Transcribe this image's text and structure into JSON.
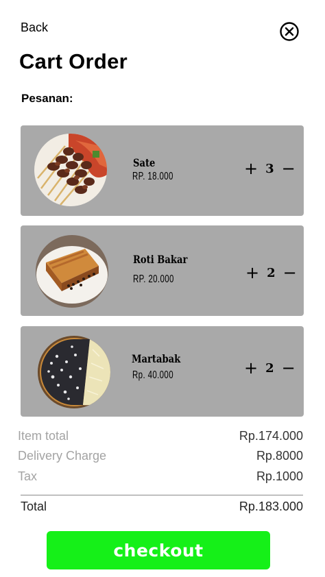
{
  "header": {
    "back_label": "Back",
    "title": "Cart Order",
    "subtitle": "Pesanan:"
  },
  "icons": {
    "close": "close-circle-icon",
    "plus": "plus-icon",
    "minus": "minus-icon"
  },
  "items": [
    {
      "name": "Sate",
      "price": "RP. 18.000",
      "qty": "3",
      "plus": "+",
      "minus": "−"
    },
    {
      "name": "Roti Bakar",
      "price": "RP. 20.000",
      "qty": "2",
      "plus": "+",
      "minus": "−"
    },
    {
      "name": "Martabak",
      "price": "Rp. 40.000",
      "qty": "2",
      "plus": "+",
      "minus": "−"
    }
  ],
  "summary": {
    "item_total_label": "Item total",
    "item_total_value": "Rp.174.000",
    "delivery_label": "Delivery Charge",
    "delivery_value": "Rp.8000",
    "tax_label": "Tax",
    "tax_value": "Rp.1000",
    "total_label": "Total",
    "total_value": "Rp.183.000"
  },
  "checkout_label": "checkout",
  "colors": {
    "card_bg": "#a9a9a9",
    "checkout_bg": "#15f018",
    "muted_text": "#a3a3a3"
  }
}
